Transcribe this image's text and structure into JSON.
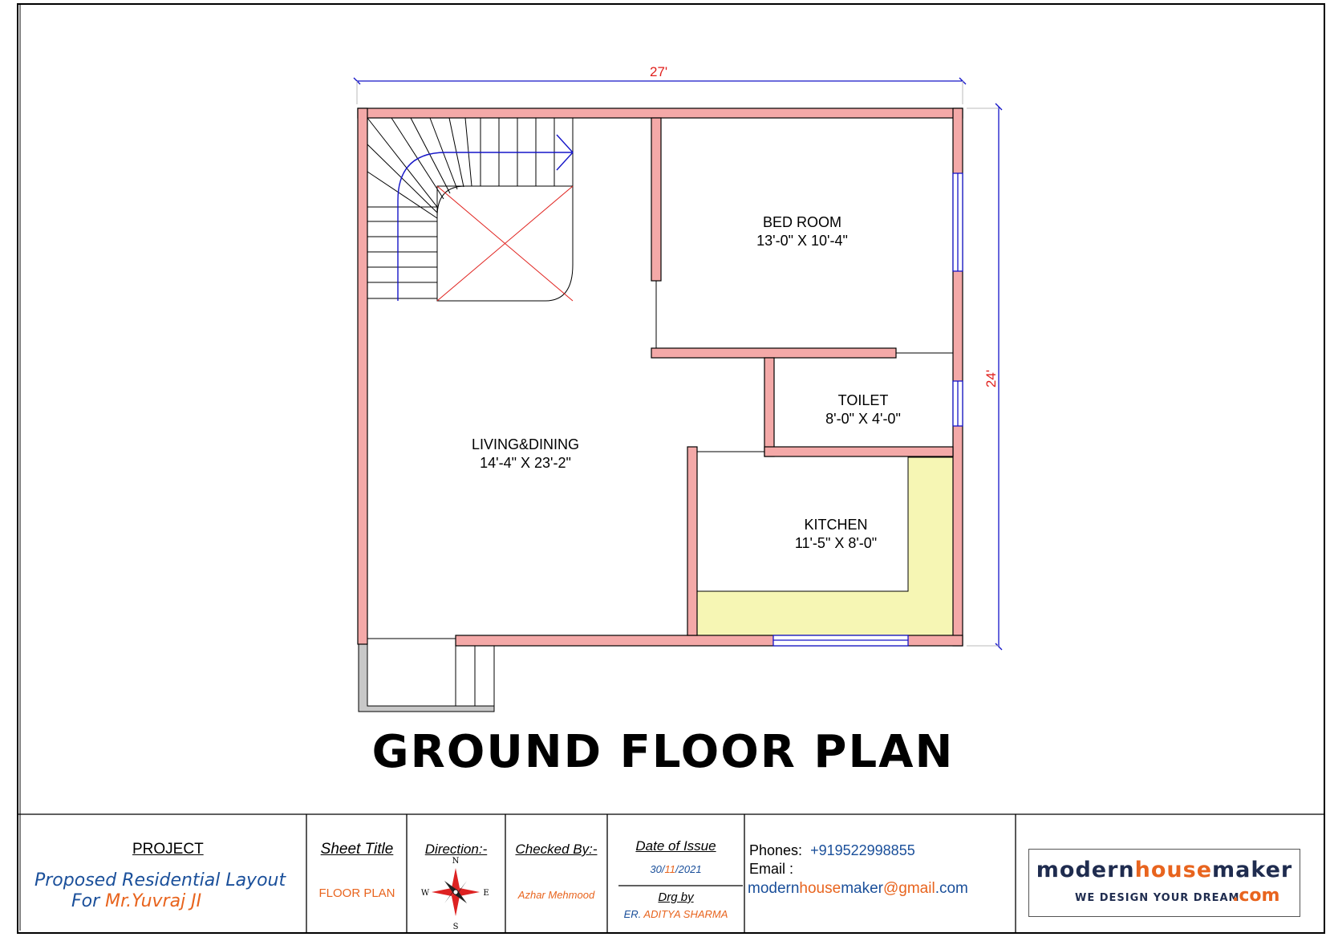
{
  "dimensions": {
    "width": "27'",
    "height": "24'"
  },
  "rooms": {
    "bedroom": {
      "name": "BED ROOM",
      "size": "13'-0\" X 10'-4\""
    },
    "toilet": {
      "name": "TOILET",
      "size": "8'-0\" X 4'-0\""
    },
    "living": {
      "name": "LIVING&DINING",
      "size": "14'-4\" X 23'-2\""
    },
    "kitchen": {
      "name": "KITCHEN",
      "size": "11'-5\" X 8'-0\""
    }
  },
  "title": "GROUND FLOOR PLAN",
  "title_block": {
    "project_label": "PROJECT",
    "project_line1": "Proposed Residential Layout",
    "project_line2_prefix": "For ",
    "project_client": "Mr.Yuvraj JI",
    "sheet_title_label": "Sheet Title",
    "sheet_title_value": "FLOOR PLAN",
    "direction_label": "Direction:-",
    "checked_by_label": "Checked By:-",
    "checked_by_value": "Azhar Mehmood",
    "date_label": "Date of Issue",
    "date_day": "30",
    "date_sep1": "/",
    "date_month": "11",
    "date_sep2": "/",
    "date_year": "2021",
    "drawn_by_label": "Drg by",
    "drawn_by_prefix": "ER. ",
    "drawn_by_value": "ADITYA SHARMA",
    "phones_label": "Phones:",
    "phones_value": "+919522998855",
    "email_label": "Email :",
    "email_part1": "modern",
    "email_part2": "house",
    "email_part3": "maker",
    "email_part4": "@gmail",
    "email_part5": ".com"
  },
  "logo": {
    "part1": "modern",
    "part2": "house",
    "part3": "maker",
    "tagline": "WE DESIGN YOUR DREAM",
    "suffix": ".com"
  },
  "colors": {
    "wall": "#f4a9a8",
    "counter": "#f6f6b4",
    "dimension_line": "#1515c8",
    "dimension_text": "#e0201c",
    "accent_orange": "#e8641e",
    "accent_blue": "#1a4f9a"
  }
}
